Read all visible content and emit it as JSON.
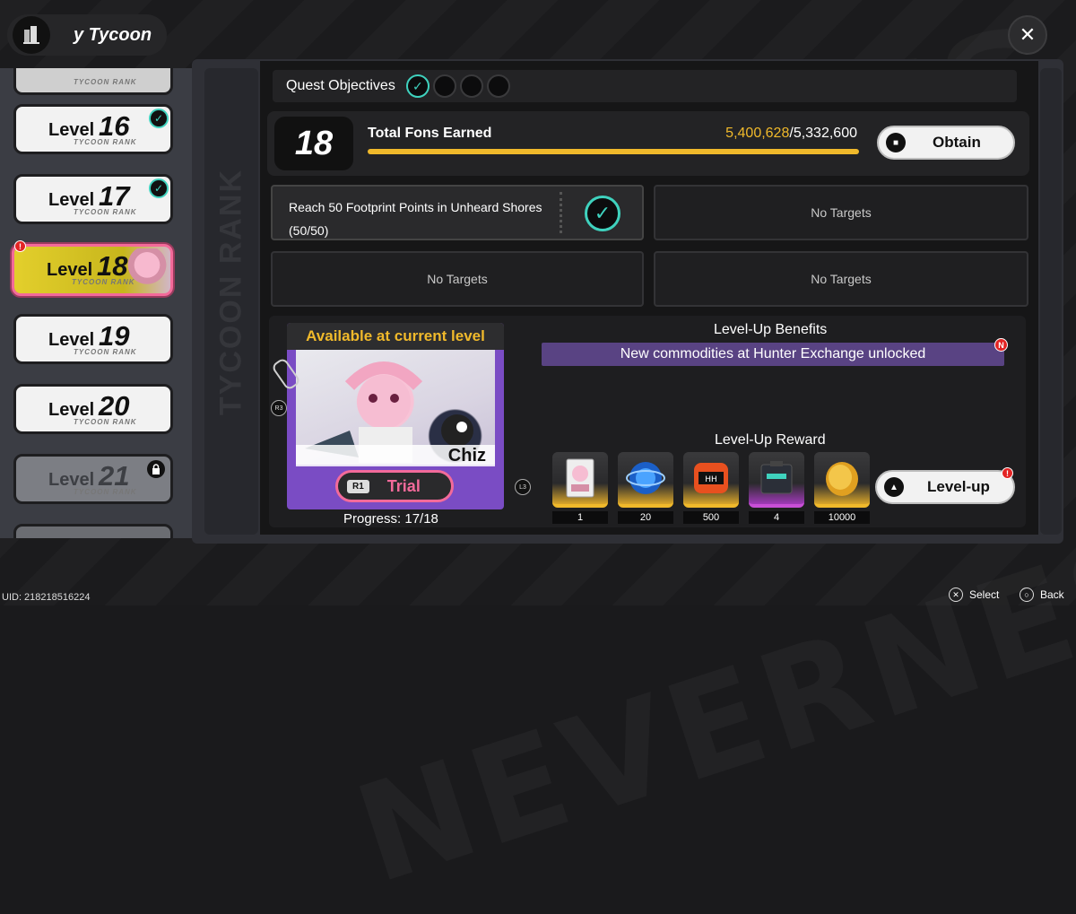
{
  "header": {
    "title": "y Tycoon"
  },
  "levels": [
    {
      "word": "Level",
      "number": "16",
      "rank": "TYCOON RANK",
      "state": "completed"
    },
    {
      "word": "Level",
      "number": "17",
      "rank": "TYCOON RANK",
      "state": "completed"
    },
    {
      "word": "Level",
      "number": "18",
      "rank": "TYCOON RANK",
      "state": "current"
    },
    {
      "word": "Level",
      "number": "19",
      "rank": "TYCOON RANK",
      "state": "normal"
    },
    {
      "word": "Level",
      "number": "20",
      "rank": "TYCOON RANK",
      "state": "normal"
    },
    {
      "word": "Level",
      "number": "21",
      "rank": "TYCOON RANK",
      "state": "locked"
    }
  ],
  "top_partial_rank": "TYCOON RANK",
  "side_label": "TYCOON RANK",
  "quest": {
    "label": "Quest Objectives",
    "objectives_completed": 1,
    "objectives_total": 4
  },
  "fons": {
    "level": "18",
    "title": "Total Fons Earned",
    "current": "5,400,628",
    "separator": "/",
    "target": "5,332,600",
    "progress": 1.0,
    "obtain_label": "Obtain"
  },
  "targets": [
    {
      "text_line1": "Reach 50 Footprint Points in Unheard Shores",
      "text_line2": "(50/50)",
      "done": true
    },
    {
      "text": "No Targets"
    },
    {
      "text": "No Targets"
    },
    {
      "text": "No Targets"
    }
  ],
  "card": {
    "header": "Available at current level",
    "character_name": "Chiz",
    "trial_key": "R1",
    "trial_label": "Trial",
    "r3_key": "R3",
    "l3_key": "L3",
    "progress_text": "Progress: 17/18"
  },
  "benefits": {
    "title": "Level-Up Benefits",
    "item": "New commodities at Hunter Exchange unlocked",
    "badge": "N"
  },
  "rewards": {
    "title": "Level-Up Reward",
    "items": [
      {
        "name": "character-card",
        "qty": "1"
      },
      {
        "name": "blue-orb",
        "qty": "20"
      },
      {
        "name": "hunter-hunter-token",
        "qty": "500"
      },
      {
        "name": "case",
        "qty": "4"
      },
      {
        "name": "gold-coin",
        "qty": "10000"
      }
    ],
    "levelup_label": "Level-up"
  },
  "footer": {
    "uid": "UID: 218218516224",
    "select": "Select",
    "back": "Back"
  },
  "colors": {
    "accent_teal": "#3fd2be",
    "accent_gold": "#f0b92b",
    "accent_pink": "#f36a9a",
    "benefit_purple": "#594383",
    "alert_red": "#e32424"
  }
}
